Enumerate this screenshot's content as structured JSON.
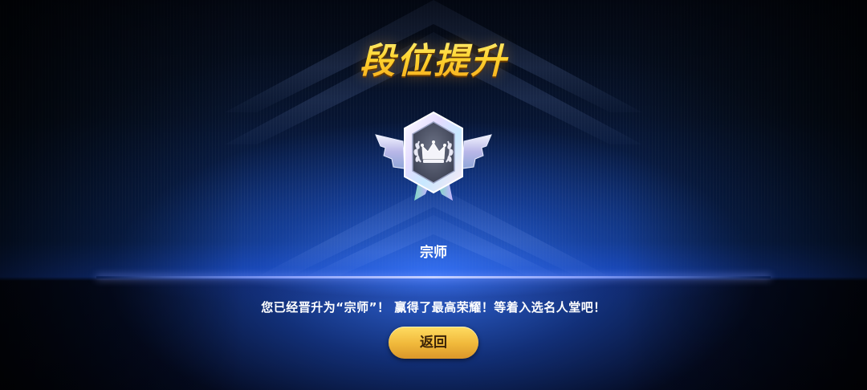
{
  "title": "段位提升",
  "badge": {
    "icon": "crown-laurel-icon",
    "rank_name": "宗师"
  },
  "message": "您已经晋升为“宗师”！ 赢得了最高荣耀！等着入选名人堂吧！",
  "back_button": {
    "label": "返回"
  },
  "colors": {
    "title_gold": "#ffd530",
    "button_gold": "#f0b83a",
    "accent_blue": "#2f6cf0"
  }
}
